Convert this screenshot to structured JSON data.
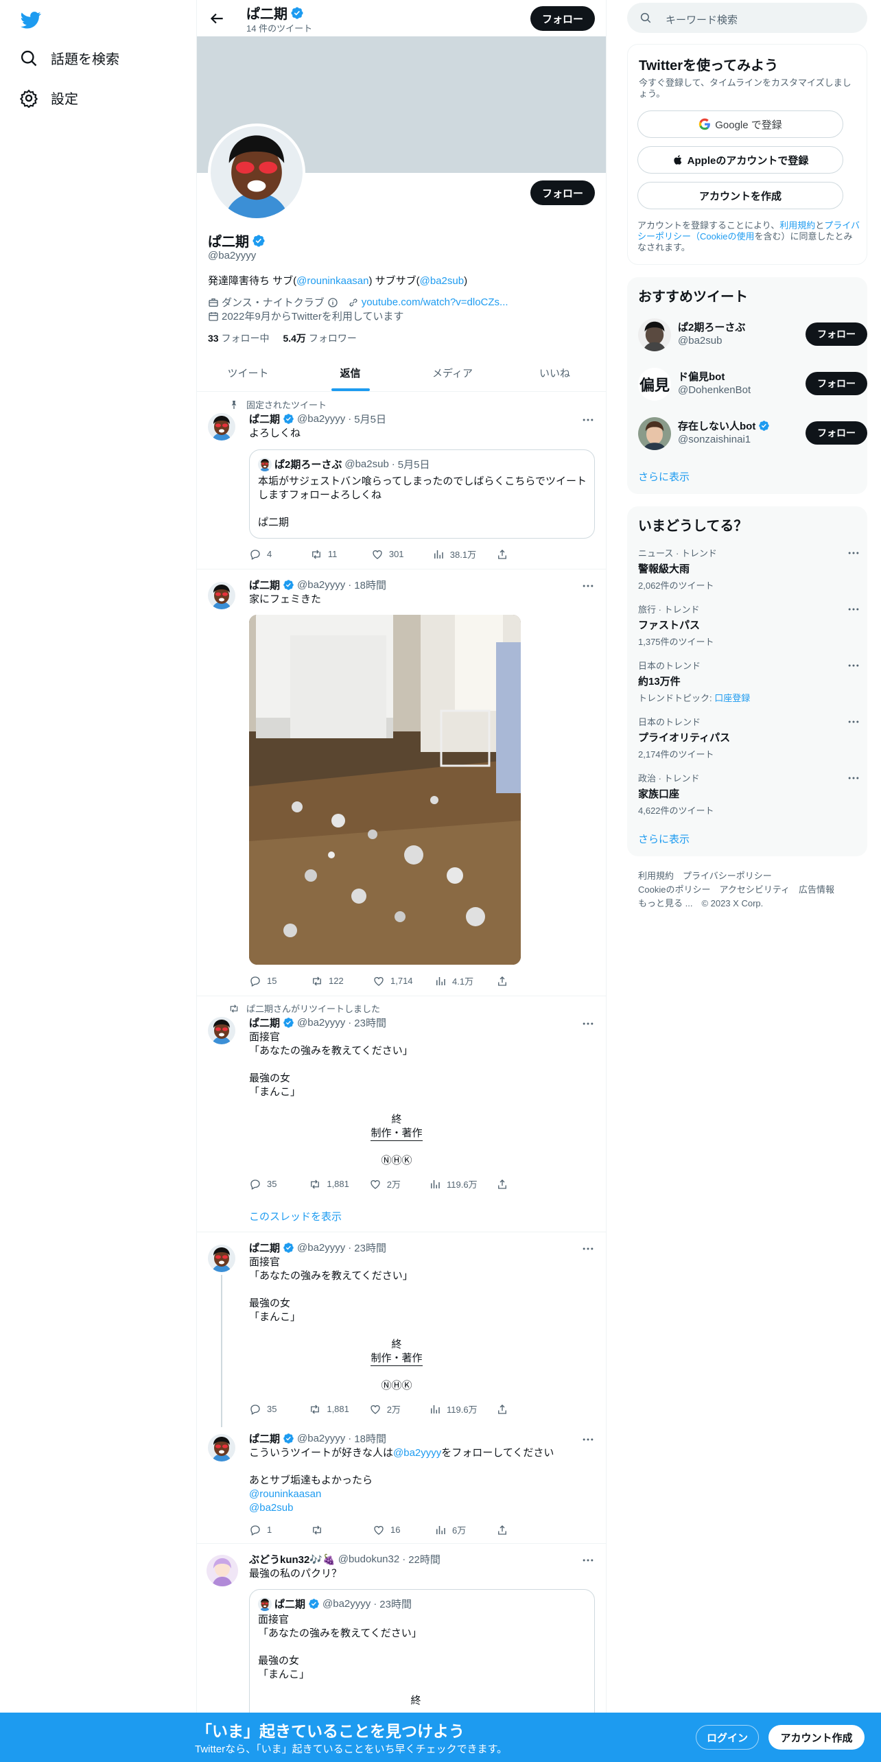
{
  "nav": {
    "explore": "話題を検索",
    "settings": "設定"
  },
  "header": {
    "name": "ぱ二期",
    "tweet_count": "14 件のツイート",
    "follow": "フォロー"
  },
  "profile": {
    "name": "ぱ二期",
    "handle": "@ba2yyyy",
    "follow": "フォロー",
    "bio_prefix": "発達障害待ち サブ(",
    "bio_link1": "@rouninkaasan",
    "bio_mid": ") サブサブ(",
    "bio_link2": "@ba2sub",
    "bio_suffix": ")",
    "category": "ダンス・ナイトクラブ",
    "url": "youtube.com/watch?v=dloCZs...",
    "joined": "2022年9月からTwitterを利用しています",
    "following_count": "33",
    "following_label": "フォロー中",
    "followers_count": "5.4万",
    "followers_label": "フォロワー"
  },
  "tabs": [
    "ツイート",
    "返信",
    "メディア",
    "いいね"
  ],
  "tweets": [
    {
      "context": "固定されたツイート",
      "name": "ぱ二期",
      "handle": "@ba2yyyy",
      "time": "5月5日",
      "text": "よろしくね",
      "quote": {
        "name": "ぱ2期ろーさぶ",
        "handle": "@ba2sub",
        "time": "5月5日",
        "text": "本垢がサジェストバン喰らってしまったのでしばらくこちらでツイートしますフォローよろしくね\n\nぱ二期"
      },
      "stats": {
        "reply": "4",
        "retweet": "11",
        "like": "301",
        "views": "38.1万"
      }
    },
    {
      "name": "ぱ二期",
      "handle": "@ba2yyyy",
      "time": "18時間",
      "text": "家にフェミきた",
      "stats": {
        "reply": "15",
        "retweet": "122",
        "like": "1,714",
        "views": "4.1万"
      }
    },
    {
      "context": "ぱ二期さんがリツイートしました",
      "name": "ぱ二期",
      "handle": "@ba2yyyy",
      "time": "23時間",
      "text": "面接官\n「あなたの強みを教えてください」\n\n最強の女\n「まんこ」",
      "credits_top": "終",
      "credits_mid": "制作・著作",
      "credits_bottom": "ⓃⒽⓀ",
      "stats": {
        "reply": "35",
        "retweet": "1,881",
        "like": "2万",
        "views": "119.6万"
      },
      "show_thread": "このスレッドを表示"
    },
    {
      "name": "ぱ二期",
      "handle": "@ba2yyyy",
      "time": "23時間",
      "text": "面接官\n「あなたの強みを教えてください」\n\n最強の女\n「まんこ」",
      "credits_top": "終",
      "credits_mid": "制作・著作",
      "credits_bottom": "ⓃⒽⓀ",
      "stats": {
        "reply": "35",
        "retweet": "1,881",
        "like": "2万",
        "views": "119.6万"
      }
    },
    {
      "name": "ぱ二期",
      "handle": "@ba2yyyy",
      "time": "18時間",
      "text_prefix": "こういうツイートが好きな人は",
      "text_link": "@ba2yyyy",
      "text_suffix": "をフォローしてください",
      "text2": "あとサブ垢達もよかったら",
      "link2": "@rouninkaasan",
      "link3": "@ba2sub",
      "stats": {
        "reply": "1",
        "retweet": "",
        "like": "16",
        "views": "6万"
      }
    },
    {
      "name": "ぶどうkun32🎶🍇",
      "handle": "@budokun32",
      "time": "22時間",
      "text": "最強の私のパクリ？",
      "quote": {
        "name": "ぱ二期",
        "handle": "@ba2yyyy",
        "time": "23時間",
        "text": "面接官\n「あなたの強みを教えてください」\n\n最強の女\n「まんこ」",
        "credits_top": "終"
      }
    }
  ],
  "right": {
    "search_placeholder": "キーワード検索",
    "signup": {
      "title": "Twitterを使ってみよう",
      "subtitle": "今すぐ登録して、タイムラインをカスタマイズしましょう。",
      "google": "Google で登録",
      "apple": "Appleのアカウントで登録",
      "create": "アカウントを作成",
      "terms_prefix": "アカウントを登録することにより、",
      "terms_link1": "利用規約",
      "terms_and": "と",
      "terms_link2": "プライバシーポリシー（Cookieの使用",
      "terms_suffix": "を含む）に同意したとみなされます。"
    },
    "recommended": {
      "title": "おすすめツイート",
      "items": [
        {
          "name": "ぱ2期ろーさぶ",
          "handle": "@ba2sub",
          "follow": "フォロー"
        },
        {
          "name": "ド偏見bot",
          "handle": "@DohenkenBot",
          "follow": "フォロー",
          "avatar_text": "偏見"
        },
        {
          "name": "存在しない人bot",
          "handle": "@sonzaishinai1",
          "follow": "フォロー"
        }
      ],
      "more": "さらに表示"
    },
    "trends": {
      "title": "いまどうしてる？",
      "items": [
        {
          "context": "ニュース · トレンド",
          "name": "警報級大雨",
          "count": "2,062件のツイート"
        },
        {
          "context": "旅行 · トレンド",
          "name": "ファストパス",
          "count": "1,375件のツイート"
        },
        {
          "context": "日本のトレンド",
          "name": "約13万件",
          "count_prefix": "トレンドトピック: ",
          "count_link": "口座登録"
        },
        {
          "context": "日本のトレンド",
          "name": "プライオリティパス",
          "count": "2,174件のツイート"
        },
        {
          "context": "政治 · トレンド",
          "name": "家族口座",
          "count": "4,622件のツイート"
        }
      ],
      "more": "さらに表示"
    },
    "footer": {
      "line1": "利用規約　プライバシーポリシー",
      "line2": "Cookieのポリシー　アクセシビリティ　広告情報",
      "line3": "もっと見る ...　© 2023 X Corp."
    }
  },
  "bottom": {
    "title": "「いま」起きていることを見つけよう",
    "subtitle": "Twitterなら、「いま」起きていることをいち早くチェックできます。",
    "login": "ログイン",
    "signup": "アカウント作成"
  },
  "colors": {
    "accent": "#1d9bf0",
    "text": "#0f1419",
    "muted": "#536471",
    "border": "#eff3f4"
  }
}
